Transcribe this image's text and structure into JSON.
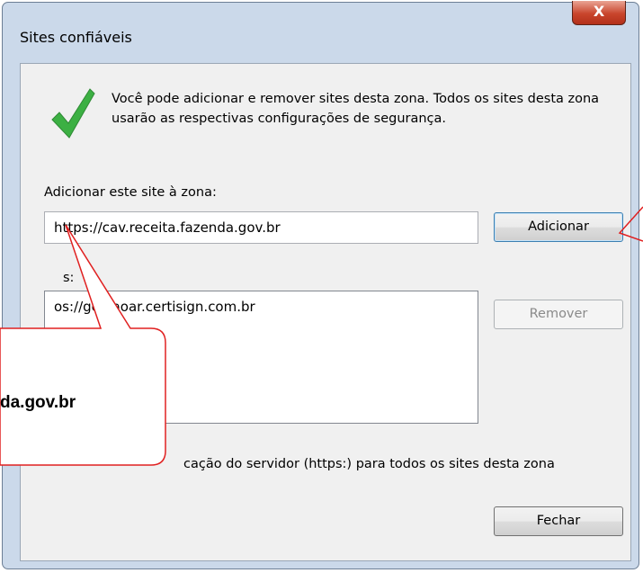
{
  "dialog": {
    "title": "Sites confiáveis",
    "close_label": "X",
    "info_text": "Você pode adicionar e remover sites desta zona. Todos os sites desta zona usarão as respectivas configurações de segurança.",
    "add_label": "Adicionar este site à zona:",
    "site_input_value": "https://cav.receita.fazenda.gov.br",
    "add_button": "Adicionar",
    "sites_label": "s:",
    "sites_list": [
      "os://gestaoar.certisign.com.br"
    ],
    "remove_button": "Remover",
    "https_check_text": "cação do servidor (https:) para todos os sites desta zona",
    "close_button": "Fechar"
  },
  "callout": {
    "text": "da.gov.br"
  },
  "colors": {
    "dialog_frame": "#cbd9ea",
    "callout_stroke": "#e02020",
    "check_green": "#3cb043"
  }
}
